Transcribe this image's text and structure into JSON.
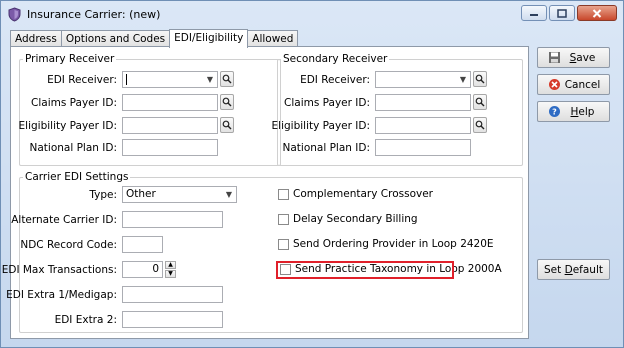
{
  "window": {
    "title": "Insurance Carrier: (new)",
    "minimize": "–",
    "maximize": "□",
    "close": "✕"
  },
  "tabs": [
    {
      "label": "Address",
      "active": false
    },
    {
      "label": "Options and Codes",
      "active": false
    },
    {
      "label": "EDI/Eligibility",
      "active": true
    },
    {
      "label": "Allowed",
      "active": false
    }
  ],
  "primary_receiver": {
    "legend": "Primary Receiver",
    "edi_receiver_label": "EDI Receiver:",
    "edi_receiver_value": "",
    "claims_payer_id_label": "Claims Payer ID:",
    "claims_payer_id_value": "",
    "eligibility_payer_id_label": "Eligibility Payer ID:",
    "eligibility_payer_id_value": "",
    "national_plan_id_label": "National Plan ID:",
    "national_plan_id_value": ""
  },
  "secondary_receiver": {
    "legend": "Secondary Receiver",
    "edi_receiver_label": "EDI Receiver:",
    "edi_receiver_value": "",
    "claims_payer_id_label": "Claims Payer ID:",
    "claims_payer_id_value": "",
    "eligibility_payer_id_label": "Eligibility Payer ID:",
    "eligibility_payer_id_value": "",
    "national_plan_id_label": "National Plan ID:",
    "national_plan_id_value": ""
  },
  "carrier_edi": {
    "legend": "Carrier EDI Settings",
    "type_label": "Type:",
    "type_value": "Other",
    "alternate_carrier_id_label": "Alternate Carrier ID:",
    "alternate_carrier_id_value": "",
    "ndc_record_code_label": "NDC Record Code:",
    "ndc_record_code_value": "",
    "edi_max_transactions_label": "EDI Max Transactions:",
    "edi_max_transactions_value": "0",
    "edi_extra1_label": "EDI Extra 1/Medigap:",
    "edi_extra1_value": "",
    "edi_extra2_label": "EDI Extra 2:",
    "edi_extra2_value": "",
    "checkboxes": [
      {
        "label": "Complementary Crossover",
        "checked": false
      },
      {
        "label": "Delay Secondary Billing",
        "checked": false
      },
      {
        "label": "Send Ordering Provider in Loop 2420E",
        "checked": false
      },
      {
        "label": "Send Practice Taxonomy in Loop 2000A",
        "checked": false
      }
    ]
  },
  "side_buttons": {
    "save_prefix": "",
    "save_underlined": "S",
    "save_rest": "ave",
    "cancel": "Cancel",
    "help_underlined": "H",
    "help_rest": "elp",
    "set_default_prefix": "Set ",
    "set_default_underlined": "D",
    "set_default_rest": "efault"
  },
  "colors": {
    "highlight": "#e0202a",
    "window_frame": "#6f8fb5"
  }
}
